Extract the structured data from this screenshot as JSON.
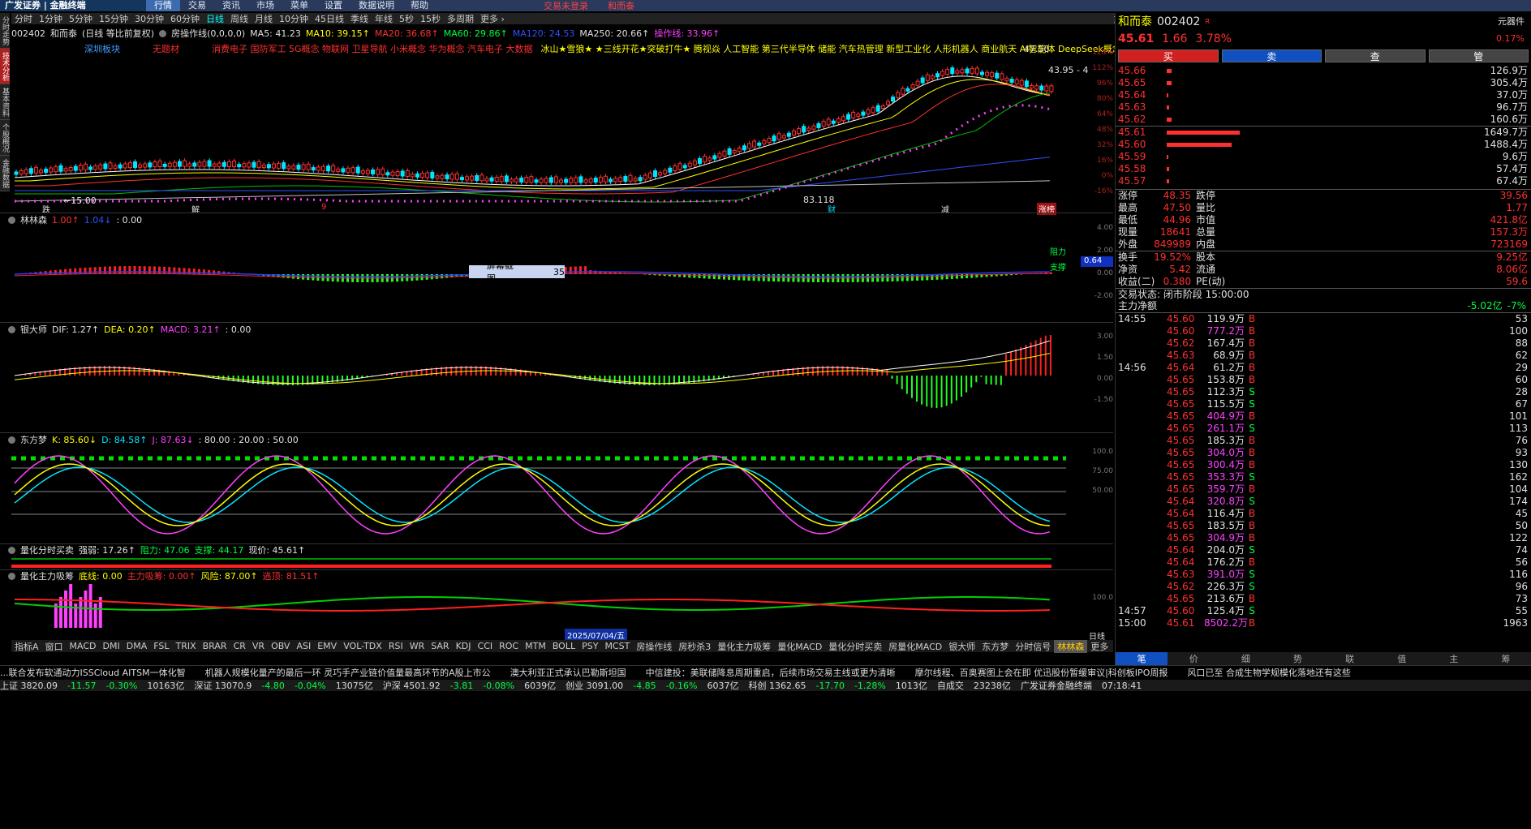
{
  "app": {
    "logo": "广发证券 | 金融终端"
  },
  "menu": [
    {
      "label": "行情",
      "active": true
    },
    {
      "label": "交易"
    },
    {
      "label": "资讯"
    },
    {
      "label": "市场"
    },
    {
      "label": "菜单"
    },
    {
      "label": "设置"
    },
    {
      "label": "数据说明"
    },
    {
      "label": "帮助"
    }
  ],
  "menu_notice": {
    "login": "交易未登录",
    "stock": "和而泰"
  },
  "periods": [
    {
      "label": "分时"
    },
    {
      "label": "1分钟"
    },
    {
      "label": "5分钟"
    },
    {
      "label": "15分钟"
    },
    {
      "label": "30分钟"
    },
    {
      "label": "60分钟"
    },
    {
      "label": "日线",
      "active": true
    },
    {
      "label": "周线"
    },
    {
      "label": "月线"
    },
    {
      "label": "10分钟"
    },
    {
      "label": "45日线"
    },
    {
      "label": "季线"
    },
    {
      "label": "年线"
    },
    {
      "label": "5秒"
    },
    {
      "label": "15秒"
    },
    {
      "label": "多周期"
    },
    {
      "label": "更多 ›"
    }
  ],
  "toolbar": [
    "复权",
    "叠加",
    "多股",
    "统计",
    "画线",
    "F10",
    "标记",
    "+自选",
    "返回"
  ],
  "left_tabs": [
    {
      "label": "分时走势"
    },
    {
      "label": "技术分析",
      "active": true
    },
    {
      "label": "基本资料"
    },
    {
      "label": "个股概况"
    },
    {
      "label": "金融数据"
    }
  ],
  "main_pane": {
    "header": {
      "code": "002402",
      "name": "和而泰",
      "mode": "(日线 等比前复权)",
      "indicator": "房操作线(0,0,0,0)",
      "ma5": "MA5: 41.23",
      "ma10": "MA10: 39.15↑",
      "ma20": "MA20: 36.68↑",
      "ma60": "MA60: 29.86↑",
      "ma120": "MA120: 24.53",
      "ma250": "MA250: 20.66↑",
      "op": "操作线: 33.96↑"
    },
    "concepts": [
      "深圳板块",
      "无题材",
      "消费电子 国防军工 5G概念 物联网 卫星导航 小米概念 华为概念 汽车电子 大数据",
      "冰山★雪狼★ ★三线开花★突破打牛★ 腾视焱 人工智能 第三代半导体 储能 汽车热管理 新型工业化 人形机器人 商业航天 AI智能体 DeepSeek概念"
    ],
    "labels": {
      "high": "47.50",
      "last": "43.95 - 4",
      "low": "←15.00",
      "mid": "83.118"
    },
    "pct_axis": [
      "128%",
      "112%",
      "96%",
      "80%",
      "64%",
      "48%",
      "32%",
      "16%",
      "0%",
      "-16%"
    ],
    "markers": [
      {
        "text": "跌"
      },
      {
        "text": "解"
      },
      {
        "text": "9"
      },
      {
        "text": "财"
      },
      {
        "text": "减"
      },
      {
        "text": "涨榜"
      }
    ]
  },
  "pane_linlinsen": {
    "title": "林林森",
    "v1": "1.00↑",
    "v2": "1.04↓",
    "v3": ": 0.00",
    "right_labels": [
      "阻力",
      "支撑"
    ],
    "value_box": "0.64",
    "tooltip": "屏幕截图",
    "tooltip_num": "35",
    "axis": [
      "4.00",
      "2.00",
      "0.00",
      "-2.00"
    ]
  },
  "pane_macd": {
    "title": "银大师",
    "dif": "DIF: 1.27↑",
    "dea": "DEA: 0.20↑",
    "macd": "MACD: 3.21↑",
    "tail": ": 0.00",
    "axis": [
      "3.00",
      "1.50",
      "0.00",
      "-1.50"
    ]
  },
  "pane_kdj": {
    "title": "东方梦",
    "k": "K: 85.60↓",
    "d": "D: 84.58↑",
    "j": "J: 87.63↓",
    "tail": ": 80.00 : 20.00 : 50.00",
    "axis": [
      "100.0",
      "75.00",
      "50.00"
    ]
  },
  "pane_qty": {
    "title": "量化分时买卖",
    "strong": "强弱: 17.26↑",
    "resist": "阻力: 47.06",
    "support": "支撑: 44.17",
    "price": "现价: 45.61↑"
  },
  "pane_main_force": {
    "title": "量化主力吸筹",
    "base": "底线: 0.00",
    "a": "主力吸筹: 0.00↑",
    "risk": "风险: 87.00↑",
    "b": "逃顶: 81.51↑",
    "axis": [
      "100.0"
    ],
    "date_tip": "2025/07/04/五",
    "axis_label": "日线"
  },
  "bottom_tabs": [
    {
      "label": "指标A"
    },
    {
      "label": "窗口"
    },
    {
      "label": "MACD"
    },
    {
      "label": "DMI"
    },
    {
      "label": "DMA"
    },
    {
      "label": "FSL"
    },
    {
      "label": "TRIX"
    },
    {
      "label": "BRAR"
    },
    {
      "label": "CR"
    },
    {
      "label": "VR"
    },
    {
      "label": "OBV"
    },
    {
      "label": "ASI"
    },
    {
      "label": "EMV"
    },
    {
      "label": "VOL-TDX"
    },
    {
      "label": "RSI"
    },
    {
      "label": "WR"
    },
    {
      "label": "SAR"
    },
    {
      "label": "KDJ"
    },
    {
      "label": "CCI"
    },
    {
      "label": "ROC"
    },
    {
      "label": "MTM"
    },
    {
      "label": "BOLL"
    },
    {
      "label": "PSY"
    },
    {
      "label": "MCST"
    },
    {
      "label": "房操作线"
    },
    {
      "label": "房秒杀3"
    },
    {
      "label": "量化主力吸筹"
    },
    {
      "label": "量化MACD"
    },
    {
      "label": "量化分时买卖"
    },
    {
      "label": "房量化MACD"
    },
    {
      "label": "银大师"
    },
    {
      "label": "东方梦"
    },
    {
      "label": "分时信号"
    },
    {
      "label": "林林森",
      "active": true
    },
    {
      "label": "更多"
    },
    {
      "label": "设置"
    },
    {
      "label": "指标B"
    },
    {
      "label": "模"
    },
    {
      "label": "板"
    }
  ],
  "right_panel": {
    "name": "和而泰",
    "code": "002402",
    "badge": "R",
    "price": "45.61",
    "chg": "1.66",
    "pct": "3.78%",
    "side_label": "元器件",
    "side_pct": "0.17%",
    "buttons": [
      "买",
      "卖",
      "查",
      "管"
    ],
    "asks": [
      {
        "p": "45.66",
        "v": "126.9万"
      },
      {
        "p": "45.65",
        "v": "305.4万"
      },
      {
        "p": "45.64",
        "v": "37.0万"
      },
      {
        "p": "45.63",
        "v": "96.7万"
      },
      {
        "p": "45.62",
        "v": "160.6万"
      }
    ],
    "bids": [
      {
        "p": "45.61",
        "v": "1649.7万"
      },
      {
        "p": "45.60",
        "v": "1488.4万"
      },
      {
        "p": "45.59",
        "v": "9.6万"
      },
      {
        "p": "45.58",
        "v": "57.4万"
      },
      {
        "p": "45.57",
        "v": "67.4万"
      }
    ],
    "stats": [
      {
        "l1": "涨停",
        "v1": "48.35",
        "l2": "跌停",
        "v2": "39.56"
      },
      {
        "l1": "最高",
        "v1": "47.50",
        "l2": "量比",
        "v2": "1.77"
      },
      {
        "l1": "最低",
        "v1": "44.96",
        "l2": "市值",
        "v2": "421.8亿"
      },
      {
        "l1": "现量",
        "v1": "18641",
        "l2": "总量",
        "v2": "157.3万"
      },
      {
        "l1": "外盘",
        "v1": "849989",
        "l2": "内盘",
        "v2": "723169"
      }
    ],
    "stats2": [
      {
        "l1": "换手",
        "v1": "19.52%",
        "l2": "股本",
        "v2": "9.25亿"
      },
      {
        "l1": "净资",
        "v1": "5.42",
        "l2": "流通",
        "v2": "8.06亿"
      },
      {
        "l1": "收益(二)",
        "v1": "0.380",
        "l2": "PE(动)",
        "v2": "59.6"
      }
    ],
    "trade_state": "交易状态: 闭市阶段 15:00:00",
    "main_net": {
      "label": "主力净额",
      "value": "-5.02亿",
      "pct": "-7%"
    },
    "ticks": [
      {
        "t": "14:55",
        "p": "45.60",
        "v": "119.9万",
        "s": "B",
        "n": "53"
      },
      {
        "t": "",
        "p": "45.60",
        "v": "777.2万",
        "s": "B",
        "n": "100"
      },
      {
        "t": "",
        "p": "45.62",
        "v": "167.4万",
        "s": "B",
        "n": "88"
      },
      {
        "t": "",
        "p": "45.63",
        "v": "68.9万",
        "s": "B",
        "n": "62"
      },
      {
        "t": "14:56",
        "p": "45.64",
        "v": "61.2万",
        "s": "B",
        "n": "29"
      },
      {
        "t": "",
        "p": "45.65",
        "v": "153.8万",
        "s": "B",
        "n": "60"
      },
      {
        "t": "",
        "p": "45.65",
        "v": "112.3万",
        "s": "S",
        "n": "28"
      },
      {
        "t": "",
        "p": "45.65",
        "v": "115.5万",
        "s": "S",
        "n": "67"
      },
      {
        "t": "",
        "p": "45.65",
        "v": "404.9万",
        "s": "B",
        "n": "101"
      },
      {
        "t": "",
        "p": "45.65",
        "v": "261.1万",
        "s": "S",
        "n": "113"
      },
      {
        "t": "",
        "p": "45.65",
        "v": "185.3万",
        "s": "B",
        "n": "76"
      },
      {
        "t": "",
        "p": "45.65",
        "v": "304.0万",
        "s": "B",
        "n": "93"
      },
      {
        "t": "",
        "p": "45.65",
        "v": "300.4万",
        "s": "B",
        "n": "130"
      },
      {
        "t": "",
        "p": "45.65",
        "v": "353.3万",
        "s": "S",
        "n": "162"
      },
      {
        "t": "",
        "p": "45.65",
        "v": "359.7万",
        "s": "B",
        "n": "104"
      },
      {
        "t": "",
        "p": "45.64",
        "v": "320.8万",
        "s": "S",
        "n": "174"
      },
      {
        "t": "",
        "p": "45.64",
        "v": "116.4万",
        "s": "B",
        "n": "45"
      },
      {
        "t": "",
        "p": "45.65",
        "v": "183.5万",
        "s": "B",
        "n": "50"
      },
      {
        "t": "",
        "p": "45.65",
        "v": "304.9万",
        "s": "B",
        "n": "122"
      },
      {
        "t": "",
        "p": "45.64",
        "v": "204.0万",
        "s": "S",
        "n": "74"
      },
      {
        "t": "",
        "p": "45.64",
        "v": "176.2万",
        "s": "B",
        "n": "56"
      },
      {
        "t": "",
        "p": "45.63",
        "v": "391.0万",
        "s": "S",
        "n": "116"
      },
      {
        "t": "",
        "p": "45.62",
        "v": "226.3万",
        "s": "S",
        "n": "96"
      },
      {
        "t": "",
        "p": "45.65",
        "v": "213.6万",
        "s": "B",
        "n": "73"
      },
      {
        "t": "14:57",
        "p": "45.60",
        "v": "125.4万",
        "s": "S",
        "n": "55"
      },
      {
        "t": "15:00",
        "p": "45.61",
        "v": "8502.2万",
        "s": "B",
        "n": "1963"
      }
    ],
    "tabs": [
      "笔",
      "价",
      "细",
      "势",
      "联",
      "值",
      "主",
      "筹"
    ]
  },
  "news": [
    "...联合发布软通动力ISSCloud AITSM一体化智",
    "机器人规模化量产的最后一环 灵巧手产业链价值量最高环节的A股上市公",
    "澳大利亚正式承认巴勒斯坦国",
    "中信建投：美联储降息周期重启，后续市场交易主线或更为清晰",
    "摩尔线程、百奥赛图上会在即 优迅股份暂缓审议|科创板IPO周报",
    "风口已至 合成生物学规模化落地还有这些"
  ],
  "status": [
    "上证 3820.09",
    "-11.57",
    "-0.30%",
    "10163亿",
    "深证 13070.9",
    "-4.80",
    "-0.04%",
    "13075亿",
    "沪深 4501.92",
    "-3.81",
    "-0.08%",
    "6039亿",
    "创业 3091.00",
    "-4.85",
    "-0.16%",
    "6037亿",
    "科创 1362.65",
    "-17.70",
    "-1.28%",
    "1013亿",
    "自成交",
    "23238亿",
    "广发证券金融终端",
    "07:18:41"
  ]
}
